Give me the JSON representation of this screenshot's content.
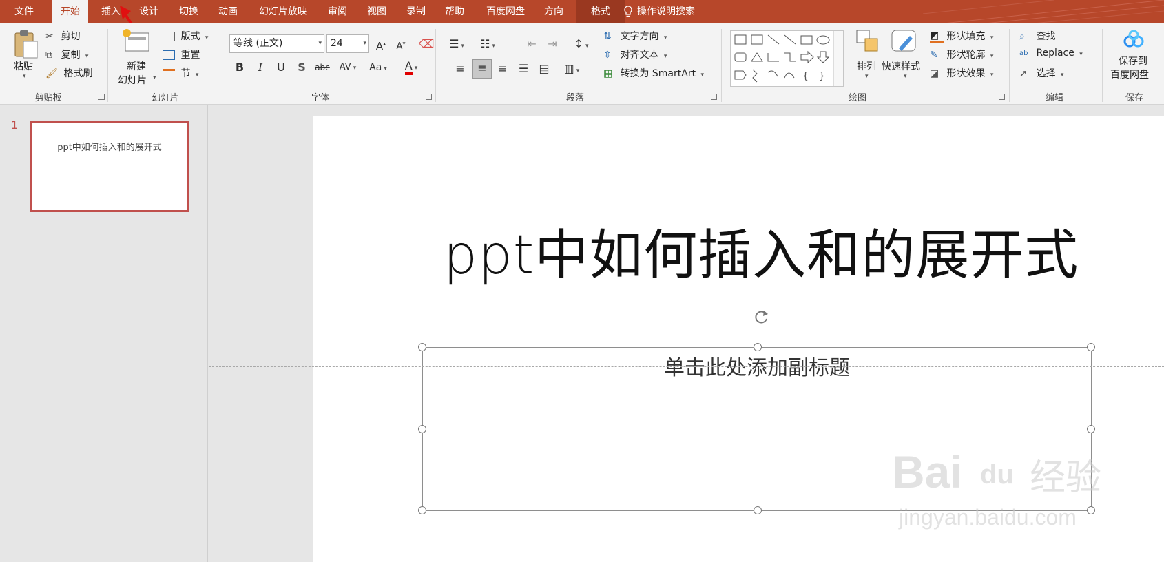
{
  "tabs": [
    "文件",
    "开始",
    "插入",
    "设计",
    "切换",
    "动画",
    "幻灯片放映",
    "审阅",
    "视图",
    "录制",
    "帮助",
    "百度网盘",
    "方向",
    "格式"
  ],
  "active_tab": "开始",
  "tell_me": "操作说明搜索",
  "clipboard": {
    "paste": "粘贴",
    "cut": "剪切",
    "copy": "复制",
    "format_painter": "格式刷",
    "label": "剪贴板"
  },
  "slides_group": {
    "new_slide_line1": "新建",
    "new_slide_line2": "幻灯片",
    "layout": "版式",
    "reset": "重置",
    "section": "节",
    "label": "幻灯片"
  },
  "font": {
    "name": "等线 (正文)",
    "size": "24",
    "label": "字体"
  },
  "paragraph": {
    "text_direction": "文字方向",
    "align_text": "对齐文本",
    "smartart": "转换为 SmartArt",
    "label": "段落"
  },
  "drawing": {
    "arrange": "排列",
    "quick_styles": "快速样式",
    "fill": "形状填充",
    "outline": "形状轮廓",
    "effects": "形状效果",
    "label": "绘图"
  },
  "editing": {
    "find": "查找",
    "replace": "Replace",
    "select": "选择",
    "label": "编辑"
  },
  "save": {
    "line1": "保存到",
    "line2": "百度网盘",
    "label": "保存"
  },
  "thumbnails": [
    {
      "number": "1",
      "title": "ppt中如何插入和的展开式"
    }
  ],
  "slide": {
    "title": "ppt中如何插入和的展开式",
    "subtitle_placeholder": "单击此处添加副标题"
  },
  "watermark": {
    "brand": "Bai",
    "paw": "du",
    "cn": "经验",
    "url": "jingyan.baidu.com"
  },
  "colors": {
    "accent": "#b7472a",
    "ribbon": "#f3f3f3",
    "font_color_bar": "#e00000"
  }
}
